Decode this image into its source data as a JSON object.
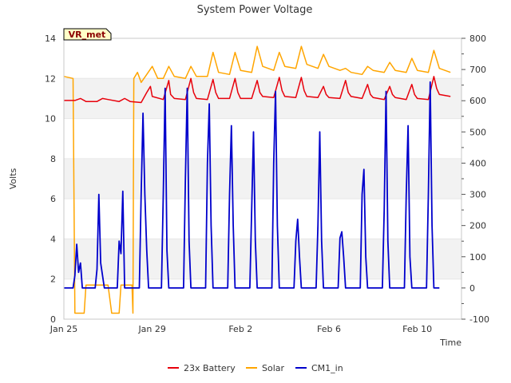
{
  "chart_data": {
    "type": "line",
    "title": "System Power Voltage",
    "badge": "VR_met",
    "xlabel": "Time",
    "ylabel": "Volts",
    "x_axis": {
      "range": [
        "2025-01-25",
        "2025-02-12"
      ],
      "ticks": [
        {
          "date": "2025-01-25",
          "label": "Jan 25"
        },
        {
          "date": "2025-01-29",
          "label": "Jan 29"
        },
        {
          "date": "2025-02-02",
          "label": "Feb 2"
        },
        {
          "date": "2025-02-06",
          "label": "Feb 6"
        },
        {
          "date": "2025-02-10",
          "label": "Feb 10"
        }
      ]
    },
    "y_left": {
      "range": [
        0,
        14
      ],
      "ticks": [
        "0",
        "2",
        "4",
        "6",
        "8",
        "10",
        "12",
        "14"
      ]
    },
    "y_right": {
      "range": [
        -100,
        800
      ],
      "ticks": [
        "-100",
        "0",
        "100",
        "200",
        "300",
        "400",
        "500",
        "600",
        "700",
        "800"
      ]
    },
    "grid": "horizontal bands",
    "legend_position": "bottom",
    "series": [
      {
        "name": "23x Battery",
        "axis": "left",
        "color": "#e8000b",
        "points": [
          [
            "2025-01-25",
            10.9
          ],
          [
            "2025-01-25T12:00",
            10.9
          ],
          [
            "2025-01-25T18:00",
            11.0
          ],
          [
            "2025-01-26",
            10.85
          ],
          [
            "2025-01-26T12:00",
            10.85
          ],
          [
            "2025-01-26T18:00",
            11.0
          ],
          [
            "2025-01-27",
            10.95
          ],
          [
            "2025-01-27T12:00",
            10.85
          ],
          [
            "2025-01-27T18:00",
            11.0
          ],
          [
            "2025-01-28",
            10.85
          ],
          [
            "2025-01-28T12:00",
            10.8
          ],
          [
            "2025-01-28T18:00",
            11.3
          ],
          [
            "2025-01-28T22:00",
            11.6
          ],
          [
            "2025-01-29",
            11.1
          ],
          [
            "2025-01-29T12:00",
            10.95
          ],
          [
            "2025-01-29T18:00",
            11.9
          ],
          [
            "2025-01-29T20:00",
            11.2
          ],
          [
            "2025-01-30",
            11.0
          ],
          [
            "2025-01-30T12:00",
            10.95
          ],
          [
            "2025-01-30T18:00",
            12.0
          ],
          [
            "2025-01-30T21:00",
            11.3
          ],
          [
            "2025-01-31",
            11.0
          ],
          [
            "2025-01-31T12:00",
            10.95
          ],
          [
            "2025-01-31T18:00",
            11.95
          ],
          [
            "2025-01-31T21:00",
            11.3
          ],
          [
            "2025-02-01",
            11.0
          ],
          [
            "2025-02-01T12:00",
            11.0
          ],
          [
            "2025-02-01T18:00",
            12.0
          ],
          [
            "2025-02-01T21:00",
            11.3
          ],
          [
            "2025-02-02",
            11.0
          ],
          [
            "2025-02-02T12:00",
            11.0
          ],
          [
            "2025-02-02T18:00",
            11.9
          ],
          [
            "2025-02-02T21:00",
            11.3
          ],
          [
            "2025-02-03",
            11.1
          ],
          [
            "2025-02-03T12:00",
            11.05
          ],
          [
            "2025-02-03T18:00",
            12.05
          ],
          [
            "2025-02-03T21:00",
            11.4
          ],
          [
            "2025-02-04",
            11.1
          ],
          [
            "2025-02-04T12:00",
            11.05
          ],
          [
            "2025-02-04T18:00",
            12.05
          ],
          [
            "2025-02-04T21:00",
            11.4
          ],
          [
            "2025-02-05",
            11.1
          ],
          [
            "2025-02-05T12:00",
            11.05
          ],
          [
            "2025-02-05T18:00",
            11.6
          ],
          [
            "2025-02-05T21:00",
            11.2
          ],
          [
            "2025-02-06",
            11.05
          ],
          [
            "2025-02-06T12:00",
            11.0
          ],
          [
            "2025-02-06T18:00",
            11.9
          ],
          [
            "2025-02-06T21:00",
            11.3
          ],
          [
            "2025-02-07",
            11.1
          ],
          [
            "2025-02-07T12:00",
            11.0
          ],
          [
            "2025-02-07T18:00",
            11.7
          ],
          [
            "2025-02-07T21:00",
            11.2
          ],
          [
            "2025-02-08",
            11.05
          ],
          [
            "2025-02-08T12:00",
            10.95
          ],
          [
            "2025-02-08T18:00",
            11.6
          ],
          [
            "2025-02-08T21:00",
            11.2
          ],
          [
            "2025-02-09",
            11.05
          ],
          [
            "2025-02-09T12:00",
            10.95
          ],
          [
            "2025-02-09T18:00",
            11.7
          ],
          [
            "2025-02-09T21:00",
            11.2
          ],
          [
            "2025-02-10",
            11.0
          ],
          [
            "2025-02-10T12:00",
            10.95
          ],
          [
            "2025-02-10T18:00",
            12.1
          ],
          [
            "2025-02-10T21:00",
            11.5
          ],
          [
            "2025-02-11",
            11.2
          ],
          [
            "2025-02-11T12:00",
            11.1
          ]
        ]
      },
      {
        "name": "Solar",
        "axis": "left",
        "color": "#ffa500",
        "points": [
          [
            "2025-01-25",
            12.1
          ],
          [
            "2025-01-25T10:00",
            12.0
          ],
          [
            "2025-01-25T12:00",
            0.3
          ],
          [
            "2025-01-25T22:00",
            0.3
          ],
          [
            "2025-01-26",
            1.7
          ],
          [
            "2025-01-26T12:00",
            1.7
          ],
          [
            "2025-01-27",
            1.7
          ],
          [
            "2025-01-27T04:00",
            0.3
          ],
          [
            "2025-01-27T12:00",
            0.3
          ],
          [
            "2025-01-27T14:00",
            1.7
          ],
          [
            "2025-01-28T02:00",
            1.7
          ],
          [
            "2025-01-28T03:00",
            0.3
          ],
          [
            "2025-01-28T04:00",
            12.0
          ],
          [
            "2025-01-28T08:00",
            12.3
          ],
          [
            "2025-01-28T12:00",
            11.8
          ],
          [
            "2025-01-28T18:00",
            12.2
          ],
          [
            "2025-01-29",
            12.6
          ],
          [
            "2025-01-29T06:00",
            12.0
          ],
          [
            "2025-01-29T12:00",
            12.0
          ],
          [
            "2025-01-29T18:00",
            12.6
          ],
          [
            "2025-01-30",
            12.1
          ],
          [
            "2025-01-30T12:00",
            12.0
          ],
          [
            "2025-01-30T18:00",
            12.6
          ],
          [
            "2025-01-31",
            12.1
          ],
          [
            "2025-01-31T12:00",
            12.1
          ],
          [
            "2025-01-31T18:00",
            13.3
          ],
          [
            "2025-02-01",
            12.3
          ],
          [
            "2025-02-01T12:00",
            12.2
          ],
          [
            "2025-02-01T18:00",
            13.3
          ],
          [
            "2025-02-02",
            12.4
          ],
          [
            "2025-02-02T12:00",
            12.3
          ],
          [
            "2025-02-02T18:00",
            13.6
          ],
          [
            "2025-02-03",
            12.6
          ],
          [
            "2025-02-03T12:00",
            12.4
          ],
          [
            "2025-02-03T18:00",
            13.3
          ],
          [
            "2025-02-04",
            12.6
          ],
          [
            "2025-02-04T12:00",
            12.5
          ],
          [
            "2025-02-04T18:00",
            13.6
          ],
          [
            "2025-02-05",
            12.7
          ],
          [
            "2025-02-05T12:00",
            12.5
          ],
          [
            "2025-02-05T18:00",
            13.2
          ],
          [
            "2025-02-06",
            12.6
          ],
          [
            "2025-02-06T12:00",
            12.4
          ],
          [
            "2025-02-06T18:00",
            12.5
          ],
          [
            "2025-02-07",
            12.3
          ],
          [
            "2025-02-07T12:00",
            12.2
          ],
          [
            "2025-02-07T18:00",
            12.6
          ],
          [
            "2025-02-08",
            12.4
          ],
          [
            "2025-02-08T12:00",
            12.3
          ],
          [
            "2025-02-08T18:00",
            12.8
          ],
          [
            "2025-02-09",
            12.4
          ],
          [
            "2025-02-09T12:00",
            12.3
          ],
          [
            "2025-02-09T18:00",
            13.0
          ],
          [
            "2025-02-10",
            12.4
          ],
          [
            "2025-02-10T12:00",
            12.3
          ],
          [
            "2025-02-10T18:00",
            13.4
          ],
          [
            "2025-02-11",
            12.5
          ],
          [
            "2025-02-11T12:00",
            12.3
          ]
        ]
      },
      {
        "name": "CM1_in",
        "axis": "right",
        "color": "#0000cc",
        "points": [
          [
            "2025-01-25",
            0
          ],
          [
            "2025-01-25T10:00",
            0
          ],
          [
            "2025-01-25T12:00",
            40
          ],
          [
            "2025-01-25T14:00",
            140
          ],
          [
            "2025-01-25T16:00",
            50
          ],
          [
            "2025-01-25T18:00",
            80
          ],
          [
            "2025-01-25T20:00",
            0
          ],
          [
            "2025-01-26",
            0
          ],
          [
            "2025-01-26T10:00",
            0
          ],
          [
            "2025-01-26T12:00",
            60
          ],
          [
            "2025-01-26T14:00",
            300
          ],
          [
            "2025-01-26T16:00",
            80
          ],
          [
            "2025-01-26T20:00",
            0
          ],
          [
            "2025-01-27",
            0
          ],
          [
            "2025-01-27T10:00",
            0
          ],
          [
            "2025-01-27T12:00",
            150
          ],
          [
            "2025-01-27T14:00",
            110
          ],
          [
            "2025-01-27T16:00",
            310
          ],
          [
            "2025-01-27T18:00",
            0
          ],
          [
            "2025-01-28",
            0
          ],
          [
            "2025-01-28T10:00",
            0
          ],
          [
            "2025-01-28T12:00",
            300
          ],
          [
            "2025-01-28T14:00",
            560
          ],
          [
            "2025-01-28T16:00",
            300
          ],
          [
            "2025-01-28T18:00",
            120
          ],
          [
            "2025-01-28T20:00",
            0
          ],
          [
            "2025-01-29",
            0
          ],
          [
            "2025-01-29T10:00",
            0
          ],
          [
            "2025-01-29T12:00",
            300
          ],
          [
            "2025-01-29T14:00",
            640
          ],
          [
            "2025-01-29T16:00",
            120
          ],
          [
            "2025-01-29T18:00",
            0
          ],
          [
            "2025-01-30",
            0
          ],
          [
            "2025-01-30T10:00",
            0
          ],
          [
            "2025-01-30T12:00",
            350
          ],
          [
            "2025-01-30T14:00",
            640
          ],
          [
            "2025-01-30T16:00",
            150
          ],
          [
            "2025-01-30T18:00",
            0
          ],
          [
            "2025-01-31",
            0
          ],
          [
            "2025-01-31T10:00",
            0
          ],
          [
            "2025-01-31T12:00",
            400
          ],
          [
            "2025-01-31T14:00",
            590
          ],
          [
            "2025-01-31T16:00",
            200
          ],
          [
            "2025-01-31T18:00",
            0
          ],
          [
            "2025-02-01",
            0
          ],
          [
            "2025-02-01T10:00",
            0
          ],
          [
            "2025-02-01T12:00",
            300
          ],
          [
            "2025-02-01T14:00",
            520
          ],
          [
            "2025-02-01T16:00",
            200
          ],
          [
            "2025-02-01T18:00",
            0
          ],
          [
            "2025-02-02",
            0
          ],
          [
            "2025-02-02T10:00",
            0
          ],
          [
            "2025-02-02T12:00",
            250
          ],
          [
            "2025-02-02T14:00",
            500
          ],
          [
            "2025-02-02T16:00",
            150
          ],
          [
            "2025-02-02T18:00",
            0
          ],
          [
            "2025-02-03",
            0
          ],
          [
            "2025-02-03T10:00",
            0
          ],
          [
            "2025-02-03T12:00",
            400
          ],
          [
            "2025-02-03T14:00",
            630
          ],
          [
            "2025-02-03T16:00",
            200
          ],
          [
            "2025-02-03T18:00",
            0
          ],
          [
            "2025-02-04",
            0
          ],
          [
            "2025-02-04T10:00",
            0
          ],
          [
            "2025-02-04T12:00",
            150
          ],
          [
            "2025-02-04T14:00",
            220
          ],
          [
            "2025-02-04T16:00",
            100
          ],
          [
            "2025-02-04T18:00",
            0
          ],
          [
            "2025-02-05",
            0
          ],
          [
            "2025-02-05T10:00",
            0
          ],
          [
            "2025-02-05T12:00",
            200
          ],
          [
            "2025-02-05T14:00",
            500
          ],
          [
            "2025-02-05T16:00",
            150
          ],
          [
            "2025-02-05T18:00",
            0
          ],
          [
            "2025-02-06",
            0
          ],
          [
            "2025-02-06T10:00",
            0
          ],
          [
            "2025-02-06T12:00",
            160
          ],
          [
            "2025-02-06T14:00",
            180
          ],
          [
            "2025-02-06T16:00",
            100
          ],
          [
            "2025-02-06T18:00",
            0
          ],
          [
            "2025-02-07",
            0
          ],
          [
            "2025-02-07T10:00",
            0
          ],
          [
            "2025-02-07T12:00",
            300
          ],
          [
            "2025-02-07T14:00",
            380
          ],
          [
            "2025-02-07T16:00",
            100
          ],
          [
            "2025-02-07T18:00",
            0
          ],
          [
            "2025-02-08",
            0
          ],
          [
            "2025-02-08T10:00",
            0
          ],
          [
            "2025-02-08T12:00",
            250
          ],
          [
            "2025-02-08T14:00",
            630
          ],
          [
            "2025-02-08T16:00",
            150
          ],
          [
            "2025-02-08T18:00",
            0
          ],
          [
            "2025-02-09",
            0
          ],
          [
            "2025-02-09T10:00",
            0
          ],
          [
            "2025-02-09T12:00",
            300
          ],
          [
            "2025-02-09T14:00",
            520
          ],
          [
            "2025-02-09T16:00",
            100
          ],
          [
            "2025-02-09T18:00",
            0
          ],
          [
            "2025-02-10",
            0
          ],
          [
            "2025-02-10T10:00",
            0
          ],
          [
            "2025-02-10T12:00",
            300
          ],
          [
            "2025-02-10T14:00",
            660
          ],
          [
            "2025-02-10T16:00",
            200
          ],
          [
            "2025-02-10T18:00",
            0
          ],
          [
            "2025-02-11",
            0
          ]
        ]
      }
    ]
  }
}
